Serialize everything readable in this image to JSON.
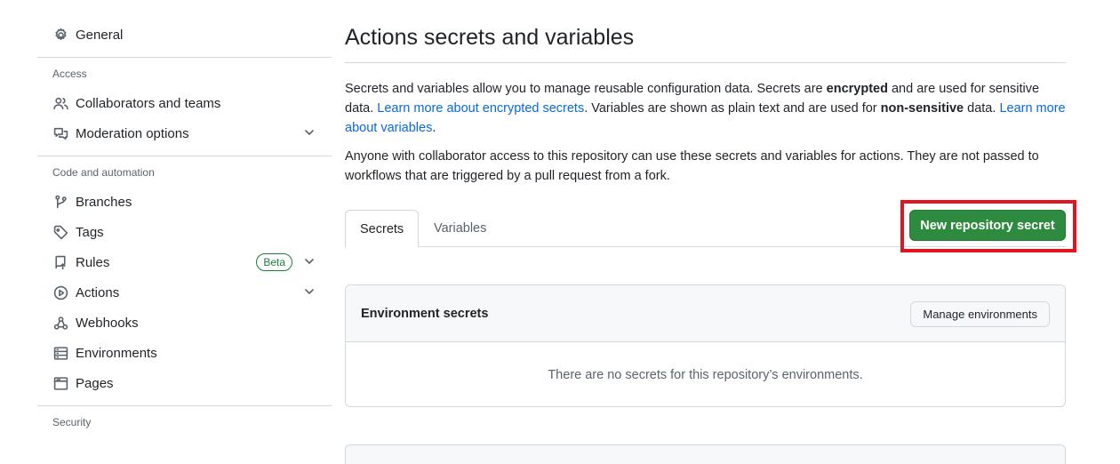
{
  "sidebar": {
    "general": {
      "label": "General",
      "icon": "gear-icon"
    },
    "sections": [
      {
        "heading": "Access"
      },
      {
        "heading": "Code and automation"
      },
      {
        "heading": "Security"
      }
    ],
    "access_items": [
      {
        "label": "Collaborators and teams",
        "icon": "people-icon"
      },
      {
        "label": "Moderation options",
        "icon": "comment-discussion-icon",
        "expandable": true
      }
    ],
    "code_items": [
      {
        "label": "Branches",
        "icon": "git-branch-icon"
      },
      {
        "label": "Tags",
        "icon": "tag-icon"
      },
      {
        "label": "Rules",
        "icon": "repo-push-icon",
        "badge": "Beta",
        "expandable": true
      },
      {
        "label": "Actions",
        "icon": "play-icon",
        "expandable": true
      },
      {
        "label": "Webhooks",
        "icon": "webhook-icon"
      },
      {
        "label": "Environments",
        "icon": "server-icon"
      },
      {
        "label": "Pages",
        "icon": "browser-icon"
      }
    ]
  },
  "main": {
    "title": "Actions secrets and variables",
    "desc1": {
      "t1": "Secrets and variables allow you to manage reusable configuration data. Secrets are ",
      "b1": "encrypted",
      "t2": " and are used for sensitive data. ",
      "link1": "Learn more about encrypted secrets",
      "t3": ". Variables are shown as plain text and are used for ",
      "b2": "non-sensitive",
      "t4": " data. ",
      "link2": "Learn more about variables",
      "t5": "."
    },
    "desc2": "Anyone with collaborator access to this repository can use these secrets and variables for actions. They are not passed to workflows that are triggered by a pull request from a fork.",
    "tabs": [
      {
        "label": "Secrets",
        "active": true
      },
      {
        "label": "Variables",
        "active": false
      }
    ],
    "new_secret_button": "New repository secret",
    "environment_box": {
      "heading": "Environment secrets",
      "button": "Manage environments",
      "empty_text": "There are no secrets for this repository’s environments."
    }
  },
  "colors": {
    "primary_button": "#2d8a3e",
    "highlight_border": "#e3141f",
    "link": "#0969da",
    "badge": "#1a7f37"
  }
}
